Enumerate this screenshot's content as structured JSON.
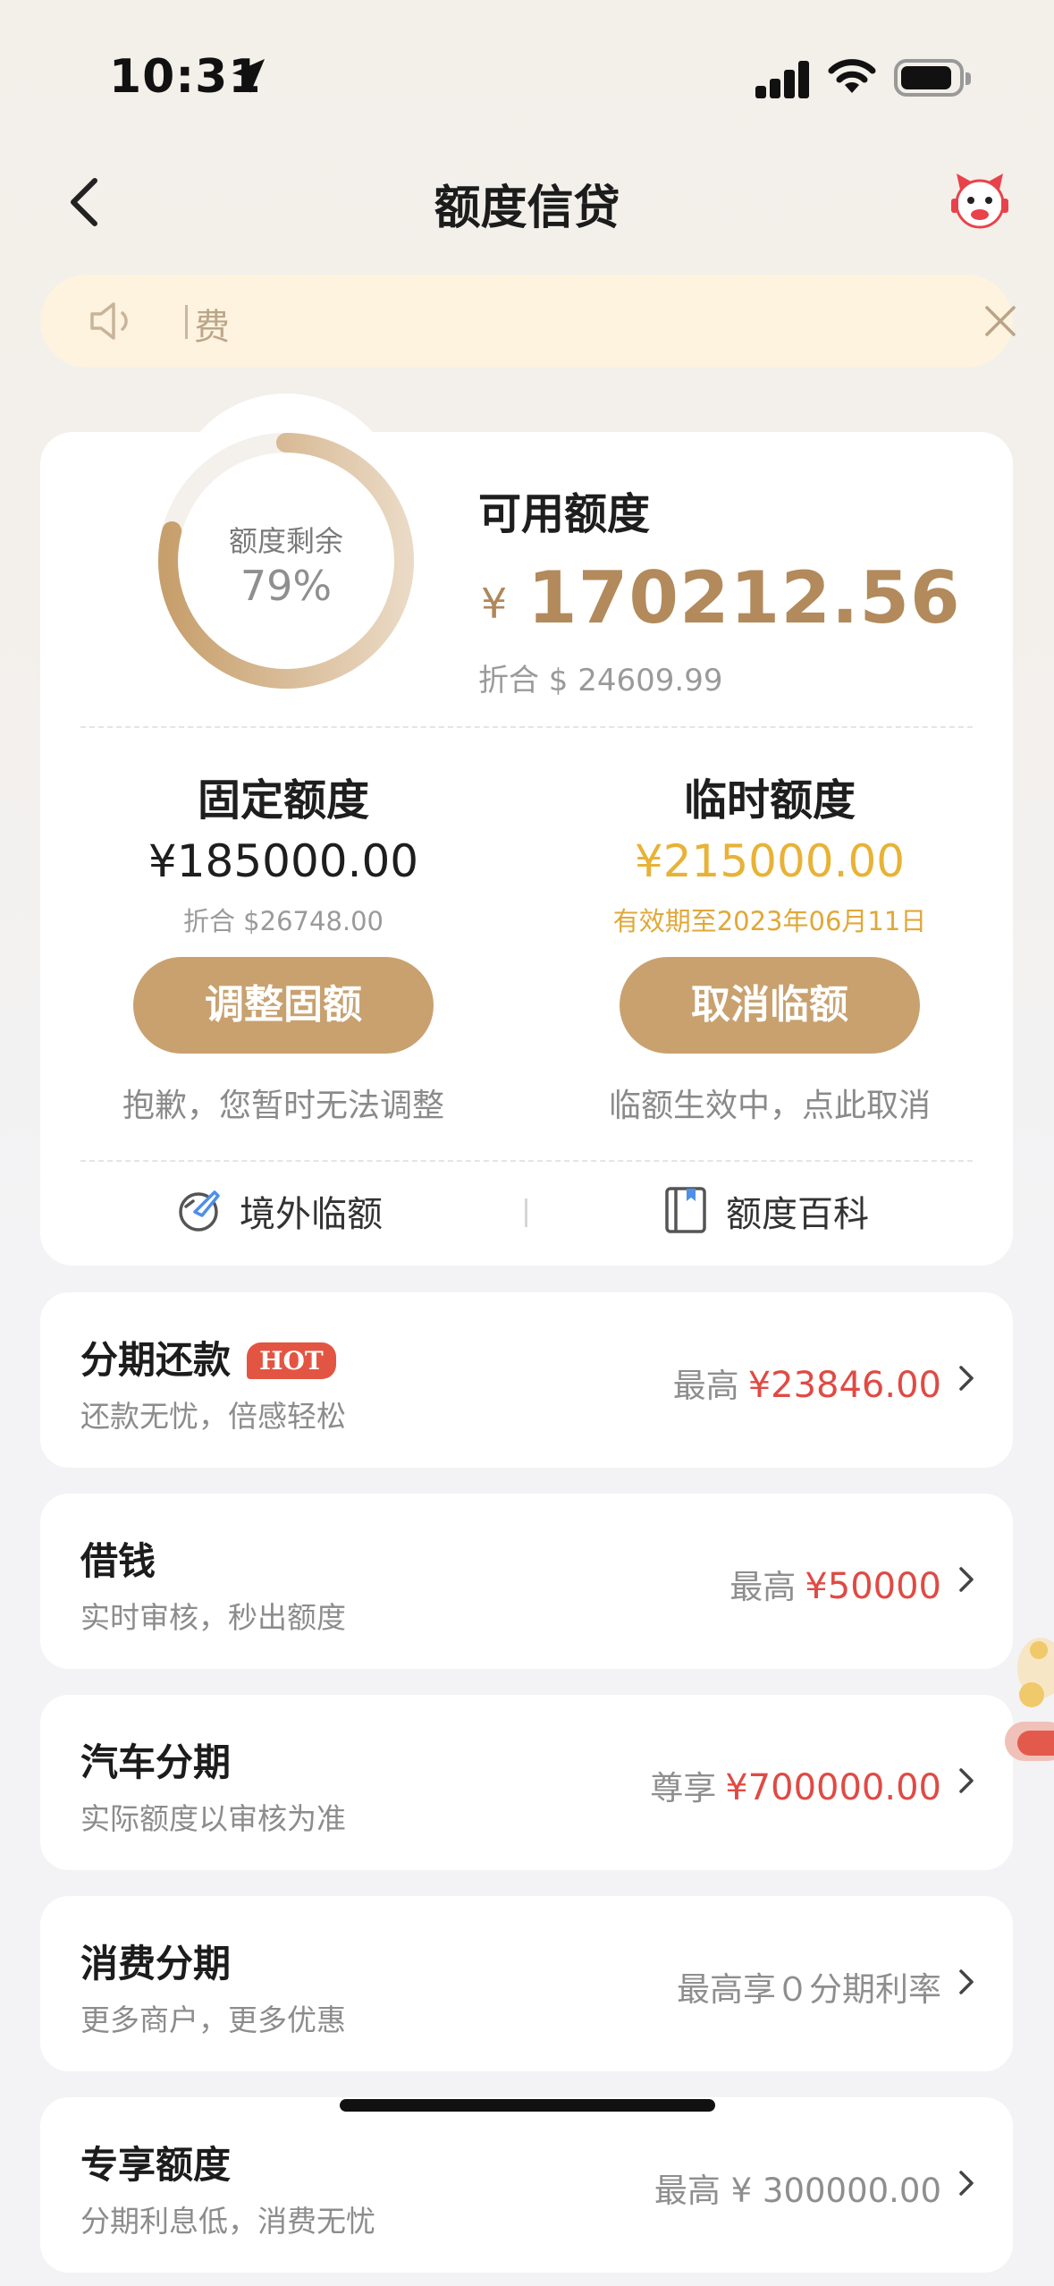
{
  "status_bar": {
    "time": "10:31"
  },
  "nav": {
    "title": "额度信贷"
  },
  "notice": {
    "text": "费"
  },
  "credit": {
    "ring_label": "额度剩余",
    "ring_percent": "79%",
    "ring_fraction": 0.79,
    "available_title": "可用额度",
    "currency_symbol": "¥",
    "available_amount": "170212.56",
    "available_converted": "折合 $ 24609.99",
    "fixed": {
      "title": "固定额度",
      "amount": "¥185000.00",
      "converted": "折合 $26748.00",
      "button": "调整固额",
      "note": "抱歉，您暂时无法调整"
    },
    "temporary": {
      "title": "临时额度",
      "amount": "¥215000.00",
      "valid_until": "有效期至2023年06月11日",
      "button": "取消临额",
      "note": "临额生效中，点此取消"
    },
    "links": {
      "overseas": "境外临额",
      "wiki": "额度百科"
    }
  },
  "rows": [
    {
      "title": "分期还款",
      "badge": "HOT",
      "sub": "还款无忧，倍感轻松",
      "prefix": "最高",
      "value": "¥23846.00"
    },
    {
      "title": "借钱",
      "sub": "实时审核，秒出额度",
      "prefix": "最高",
      "value": "¥50000"
    },
    {
      "title": "汽车分期",
      "sub": "实际额度以审核为准",
      "prefix": "尊享",
      "value": "¥700000.00"
    },
    {
      "title": "消费分期",
      "sub": "更多商户，更多优惠",
      "right_text": "最高享０分期利率"
    },
    {
      "title": "专享额度",
      "sub": "分期利息低，消费无忧",
      "right_text": "最高 ¥ 300000.00"
    }
  ],
  "colors": {
    "gold": "#c8a16f",
    "amount_gold": "#b28a5b",
    "temp_gold": "#e8b236",
    "red": "#e04a44"
  }
}
